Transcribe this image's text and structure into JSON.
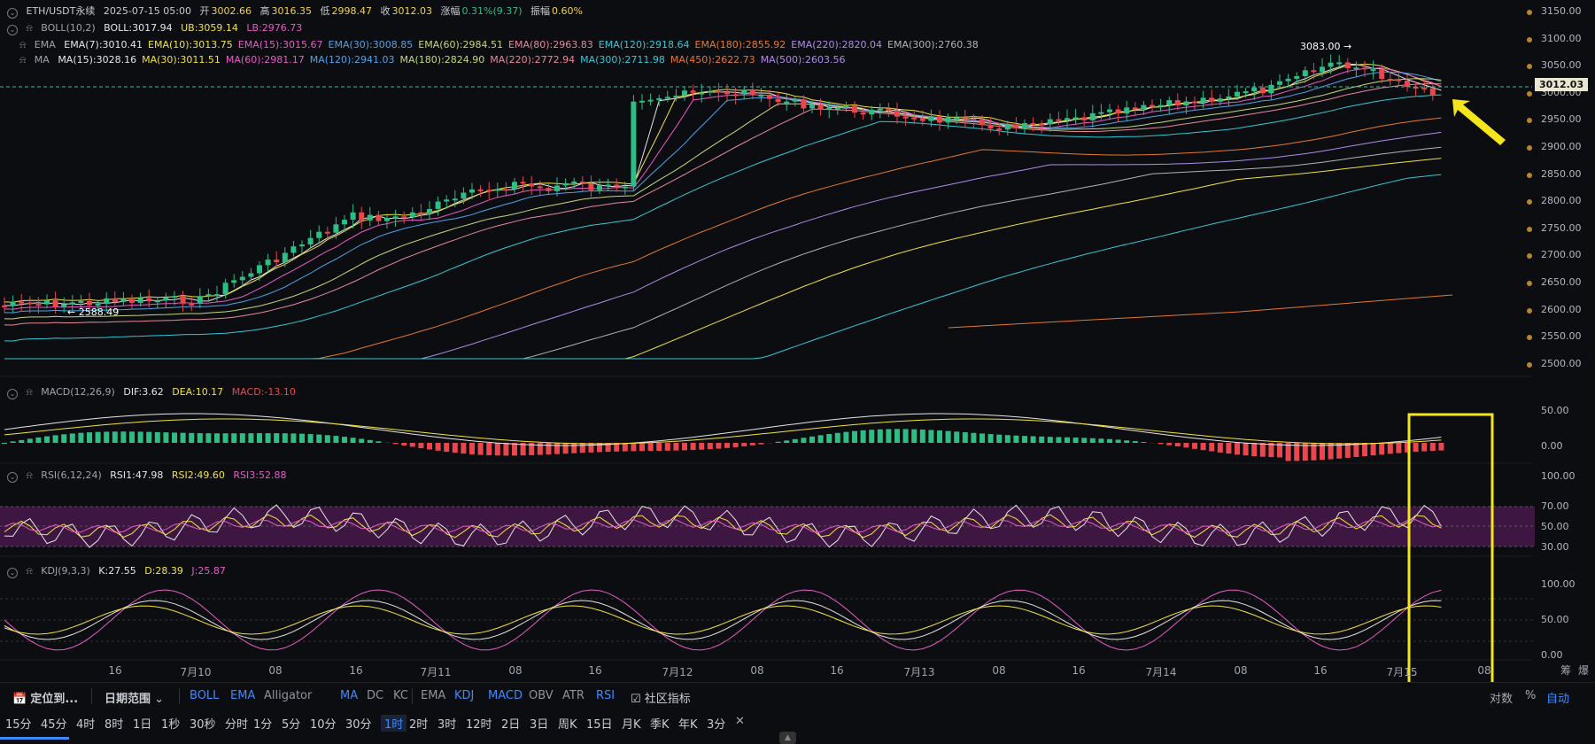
{
  "header": {
    "symbol": "ETH/USDT永续",
    "datetime": "2025-07-15 05:00",
    "open_label": "开",
    "open": "3002.66",
    "high_label": "高",
    "high": "3016.35",
    "low_label": "低",
    "low": "2998.47",
    "close_label": "收",
    "close": "3012.03",
    "change_label": "涨幅",
    "change": "0.31%(9.37)",
    "amp_label": "振幅",
    "amp": "0.60%"
  },
  "boll": {
    "name": "BOLL(10,2)",
    "boll": "BOLL:3017.94",
    "ub": "UB:3059.14",
    "lb": "LB:2976.73"
  },
  "ema": {
    "name": "EMA",
    "items": [
      {
        "t": "EMA(7):3010.41",
        "c": "#e6e6e6"
      },
      {
        "t": "EMA(10):3013.75",
        "c": "#f2e33c"
      },
      {
        "t": "EMA(15):3015.67",
        "c": "#e55cc6"
      },
      {
        "t": "EMA(30):3008.85",
        "c": "#4fa3e8"
      },
      {
        "t": "EMA(60):2984.51",
        "c": "#c4d97a"
      },
      {
        "t": "EMA(80):2963.83",
        "c": "#e58a9b"
      },
      {
        "t": "EMA(120):2918.64",
        "c": "#35c9d6"
      },
      {
        "t": "EMA(180):2855.92",
        "c": "#e57a2e"
      },
      {
        "t": "EMA(220):2820.04",
        "c": "#b08be8"
      },
      {
        "t": "EMA(300):2760.38",
        "c": "#b3b3b3"
      }
    ]
  },
  "ma": {
    "name": "MA",
    "items": [
      {
        "t": "MA(15):3028.16",
        "c": "#e6e6e6"
      },
      {
        "t": "MA(30):3011.51",
        "c": "#f2e33c"
      },
      {
        "t": "MA(60):2981.17",
        "c": "#e55cc6"
      },
      {
        "t": "MA(120):2941.03",
        "c": "#4fa3e8"
      },
      {
        "t": "MA(180):2824.90",
        "c": "#c4d97a"
      },
      {
        "t": "MA(220):2772.94",
        "c": "#e58a9b"
      },
      {
        "t": "MA(300):2711.98",
        "c": "#35c9d6"
      },
      {
        "t": "MA(450):2622.73",
        "c": "#e57a2e"
      },
      {
        "t": "MA(500):2603.56",
        "c": "#b08be8"
      }
    ]
  },
  "price_axis": [
    "3150.00",
    "3100.00",
    "3050.00",
    "3000.00",
    "2950.00",
    "2900.00",
    "2850.00",
    "2800.00",
    "2750.00",
    "2700.00",
    "2650.00",
    "2600.00",
    "2550.00",
    "2500.00"
  ],
  "current_price": "3012.03",
  "high_marker": "3083.00",
  "low_marker": "2588.49",
  "macd": {
    "name": "MACD(12,26,9)",
    "dif": "DIF:3.62",
    "dea": "DEA:10.17",
    "macd": "MACD:-13.10",
    "axis": [
      "50.00",
      "0.00"
    ]
  },
  "rsi": {
    "name": "RSI(6,12,24)",
    "r1": "RSI1:47.98",
    "r2": "RSI2:49.60",
    "r3": "RSI3:52.88",
    "axis": [
      "100.00",
      "70.00",
      "50.00",
      "30.00"
    ]
  },
  "kdj": {
    "name": "KDJ(9,3,3)",
    "k": "K:27.55",
    "d": "D:28.39",
    "j": "J:25.87",
    "axis": [
      "100.00",
      "50.00",
      "0.00"
    ]
  },
  "time_axis": [
    "16",
    "7月10",
    "08",
    "16",
    "7月11",
    "08",
    "16",
    "7月12",
    "08",
    "16",
    "7月13",
    "08",
    "16",
    "7月14",
    "08",
    "16",
    "7月15",
    "08"
  ],
  "axis_corner": [
    "筹",
    "爆"
  ],
  "toolbar": {
    "locate": "定位到...",
    "date_range": "日期范围",
    "main_indicators": [
      "BOLL",
      "EMA",
      "Alligator",
      "MA",
      "DC",
      "KC"
    ],
    "sub_indicators": [
      "EMA",
      "KDJ",
      "MACD",
      "OBV",
      "ATR",
      "RSI"
    ],
    "community": "社区指标",
    "right": [
      "对数",
      "%",
      "自动"
    ]
  },
  "intervals": [
    "15分",
    "45分",
    "4时",
    "8时",
    "1日",
    "1秒",
    "30秒",
    "分时",
    "1分",
    "5分",
    "10分",
    "30分",
    "1时",
    "2时",
    "3时",
    "12时",
    "2日",
    "3日",
    "周K",
    "15日",
    "月K",
    "季K",
    "年K",
    "3分"
  ],
  "active_interval": "1时",
  "colors": {
    "up": "#2ebd85",
    "down": "#e9474d",
    "accent": "#3d8bff",
    "highlight": "#f5e61b"
  }
}
